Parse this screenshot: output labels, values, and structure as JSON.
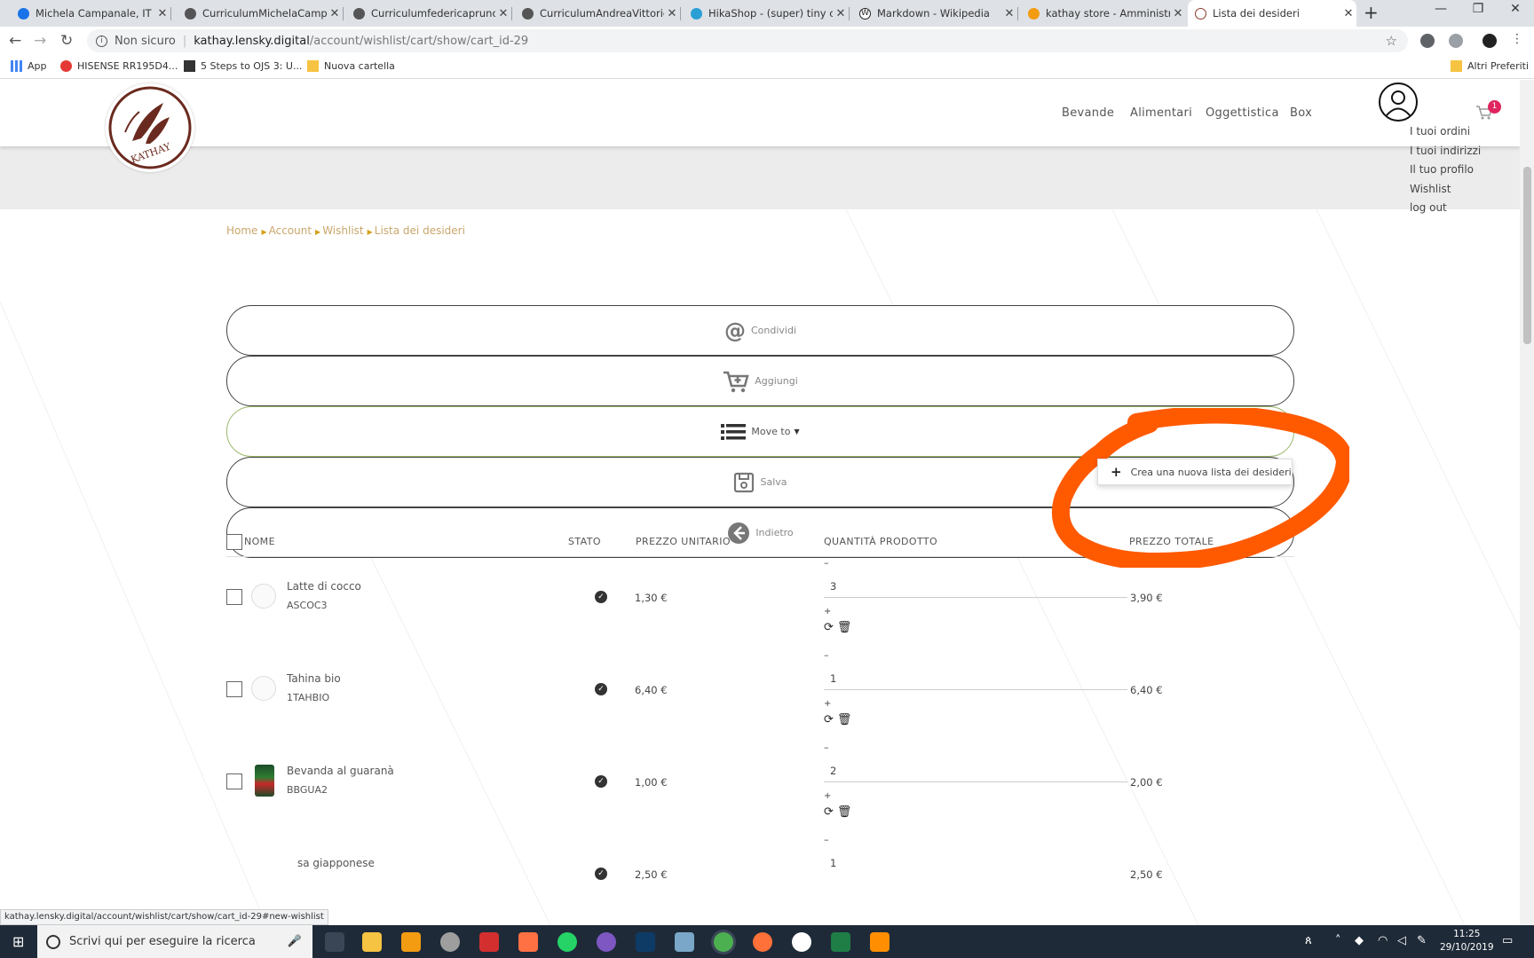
{
  "browser": {
    "tabs": [
      {
        "title": "Michela Campanale, IT - De",
        "icon_color": "#1a73e8"
      },
      {
        "title": "CurriculumMichelaCampana",
        "icon_color": "#555"
      },
      {
        "title": "Curriculumfedericaprunotto",
        "icon_color": "#555"
      },
      {
        "title": "CurriculumAndreaVittorio.p",
        "icon_color": "#555"
      },
      {
        "title": "HikaShop - (super) tiny con",
        "icon_color": "#2a9fd6"
      },
      {
        "title": "Markdown - Wikipedia",
        "icon_color": "#222"
      },
      {
        "title": "kathay store - Amministrazi",
        "icon_color": "#f39c12"
      },
      {
        "title": "Lista dei desideri",
        "icon_color": "#8a3b2b"
      }
    ],
    "address": {
      "security": "Non sicuro",
      "host": "kathay.lensky.digital",
      "path": "/account/wishlist/cart/show/cart_id-29"
    },
    "bookmarks": [
      {
        "label": "App",
        "color": "#4285f4"
      },
      {
        "label": "HISENSE RR195D4...",
        "color": "#e53935"
      },
      {
        "label": "5 Steps to OJS 3: U...",
        "color": "#333"
      },
      {
        "label": "Nuova cartella",
        "color": "#f6c342"
      }
    ],
    "bookmarks_right": "Altri Preferiti",
    "status_url": "kathay.lensky.digital/account/wishlist/cart/show/cart_id-29#new-wishlist"
  },
  "site": {
    "logo_text": "KATHAY",
    "nav": [
      "Bevande",
      "Alimentari",
      "Oggettistica",
      "Box"
    ],
    "cart_count": "1",
    "user_menu": [
      "I tuoi ordini",
      "I tuoi indirizzi",
      "Il tuo profilo",
      "Wishlist",
      "log out"
    ],
    "breadcrumb": [
      "Home",
      "Account",
      "Wishlist",
      "Lista dei desideri"
    ],
    "actions": {
      "share": "Condividi",
      "add": "Aggiungi",
      "move": "Move to",
      "save": "Salva",
      "back": "Indietro"
    },
    "dropdown_item": "Crea una nuova lista dei desideri",
    "table": {
      "headers": {
        "name": "NOME",
        "status": "STATO",
        "unit_price": "PREZZO UNITARIO",
        "quantity": "QUANTITÀ PRODOTTO",
        "total": "PREZZO TOTALE"
      },
      "rows": [
        {
          "name": "Latte di cocco",
          "code": "ASCOC3",
          "price": "1,30 €",
          "qty": "3",
          "total": "3,90 €"
        },
        {
          "name": "Tahina bio",
          "code": "1TAHBIO",
          "price": "6,40 €",
          "qty": "1",
          "total": "6,40 €"
        },
        {
          "name": "Bevanda al guaranà",
          "code": "BBGUA2",
          "price": "1,00 €",
          "qty": "2",
          "total": "2,00 €"
        },
        {
          "name": "sa giapponese",
          "code": "",
          "price": "2,50 €",
          "qty": "1",
          "total": "2,50 €"
        }
      ],
      "qty_minus": "–",
      "qty_plus": "+"
    }
  },
  "taskbar": {
    "search_placeholder": "Scrivi qui per eseguire la ricerca",
    "time": "11:25",
    "date": "29/10/2019"
  },
  "colors": {
    "accent_gold": "#c9a66b",
    "annotation_orange": "#ff5a00",
    "logo_brown": "#6b2a1f"
  }
}
